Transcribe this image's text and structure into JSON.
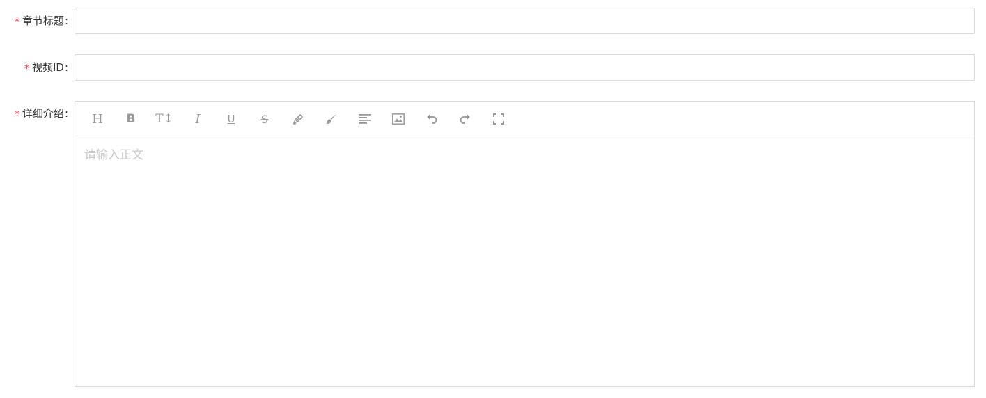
{
  "form": {
    "title_field": {
      "required_mark": "*",
      "label": "章节标题",
      "colon": ":",
      "value": "",
      "placeholder": ""
    },
    "video_field": {
      "required_mark": "*",
      "label": "视频ID",
      "colon": ":",
      "value": "",
      "placeholder": ""
    },
    "description_field": {
      "required_mark": "*",
      "label": "详细介绍",
      "colon": ":",
      "placeholder": "请输入正文",
      "toolbar": [
        {
          "name": "heading",
          "glyph": "H"
        },
        {
          "name": "bold",
          "glyph": "B"
        },
        {
          "name": "font-size",
          "glyph": "T↕"
        },
        {
          "name": "italic",
          "glyph": "I"
        },
        {
          "name": "underline",
          "glyph": "U"
        },
        {
          "name": "strikethrough",
          "glyph": "S"
        },
        {
          "name": "pen-icon"
        },
        {
          "name": "brush-icon"
        },
        {
          "name": "align-left-icon"
        },
        {
          "name": "image-icon"
        },
        {
          "name": "undo-icon"
        },
        {
          "name": "redo-icon"
        },
        {
          "name": "fullscreen-icon"
        }
      ]
    }
  },
  "colors": {
    "required": "#e0393e",
    "border": "#d9d9d9",
    "toolbar_icon": "#999999",
    "placeholder": "#c9c9c9"
  }
}
